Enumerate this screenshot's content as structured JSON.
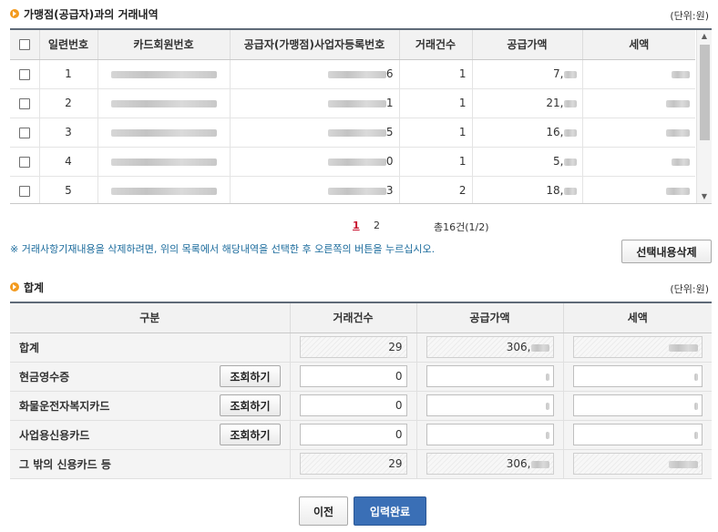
{
  "section1": {
    "title": "가맹점(공급자)과의 거래내역",
    "unit": "(단위:원)"
  },
  "grid": {
    "headers": [
      "일련번호",
      "카드회원번호",
      "공급자(가맹점)사업자등록번호",
      "거래건수",
      "공급가액",
      "세액"
    ],
    "rows": [
      {
        "no": "1",
        "biz_tail": "6",
        "count": "1",
        "supply": "7,"
      },
      {
        "no": "2",
        "biz_tail": "1",
        "count": "1",
        "supply": "21,"
      },
      {
        "no": "3",
        "biz_tail": "5",
        "count": "1",
        "supply": "16,"
      },
      {
        "no": "4",
        "biz_tail": "0",
        "count": "1",
        "supply": "5,"
      },
      {
        "no": "5",
        "biz_tail": "3",
        "count": "2",
        "supply": "18,"
      }
    ]
  },
  "pager": {
    "pages": [
      "1",
      "2"
    ],
    "active": "1",
    "total": "총16건(1/2)"
  },
  "note": "※ 거래사항기재내용을 삭제하려면, 위의 목록에서 해당내역을 선택한 후 오른쪽의 버튼을 누르십시오.",
  "delete_button": "선택내용삭제",
  "section2": {
    "title": "합계",
    "unit": "(단위:원)"
  },
  "sum": {
    "headers": [
      "구분",
      "거래건수",
      "공급가액",
      "세액"
    ],
    "rows": [
      {
        "label": "합계",
        "button": "",
        "count": "29",
        "supply": "306,",
        "editable": false
      },
      {
        "label": "현금영수증",
        "button": "조회하기",
        "count": "0",
        "supply": "",
        "editable": true
      },
      {
        "label": "화물운전자복지카드",
        "button": "조회하기",
        "count": "0",
        "supply": "",
        "editable": true
      },
      {
        "label": "사업용신용카드",
        "button": "조회하기",
        "count": "0",
        "supply": "",
        "editable": true
      },
      {
        "label": "그 밖의 신용카드 등",
        "button": "",
        "count": "29",
        "supply": "306,",
        "editable": false
      }
    ]
  },
  "footer": {
    "prev": "이전",
    "done": "입력완료"
  },
  "colors": {
    "accent": "#f39a1e",
    "primary_button": "#3a6fb6",
    "header_border": "#5e6a78",
    "active_page": "#c8102e",
    "note_text": "#1b6b9c"
  }
}
